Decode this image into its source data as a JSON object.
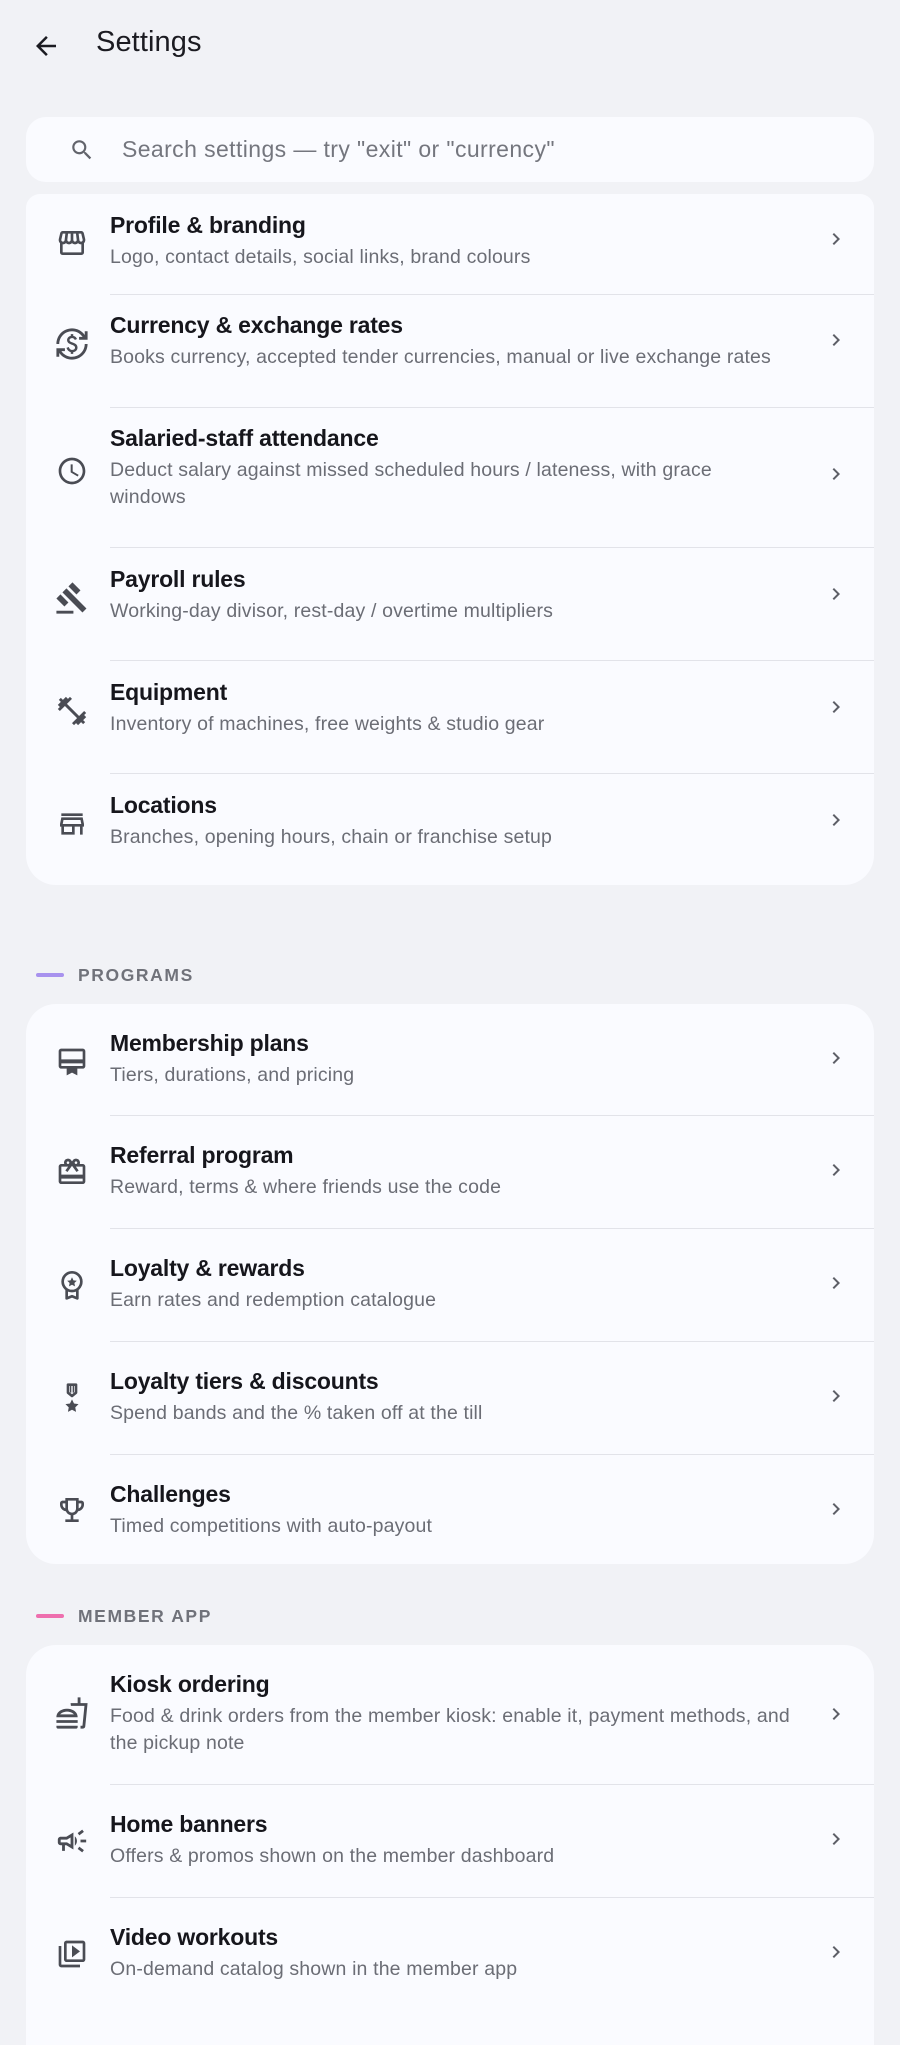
{
  "header": {
    "title": "Settings"
  },
  "search": {
    "placeholder": "Search settings — try \"exit\" or \"currency\""
  },
  "general": {
    "items": [
      {
        "title": "Profile & branding",
        "subtitle": "Logo, contact details, social links, brand colours",
        "icon": "storefront-icon"
      },
      {
        "title": "Currency & exchange rates",
        "subtitle": "Books currency, accepted tender currencies, manual or live exchange rates",
        "icon": "currency-exchange-icon"
      },
      {
        "title": "Salaried-staff attendance",
        "subtitle": "Deduct salary against missed scheduled hours / lateness, with grace windows",
        "icon": "clock-icon"
      },
      {
        "title": "Payroll rules",
        "subtitle": "Working-day divisor, rest-day / overtime multipliers",
        "icon": "gavel-icon"
      },
      {
        "title": "Equipment",
        "subtitle": "Inventory of machines, free weights & studio gear",
        "icon": "fitness-icon"
      },
      {
        "title": "Locations",
        "subtitle": "Branches, opening hours, chain or franchise setup",
        "icon": "store-icon"
      }
    ]
  },
  "programs": {
    "label": "PROGRAMS",
    "accent": "#a892ee",
    "items": [
      {
        "title": "Membership plans",
        "subtitle": "Tiers, durations, and pricing",
        "icon": "card-membership-icon"
      },
      {
        "title": "Referral program",
        "subtitle": "Reward, terms & where friends use the code",
        "icon": "gift-card-icon"
      },
      {
        "title": "Loyalty & rewards",
        "subtitle": "Earn rates and redemption catalogue",
        "icon": "award-star-icon"
      },
      {
        "title": "Loyalty tiers & discounts",
        "subtitle": "Spend bands and the % taken off at the till",
        "icon": "medal-icon"
      },
      {
        "title": "Challenges",
        "subtitle": "Timed competitions with auto-payout",
        "icon": "trophy-icon"
      }
    ]
  },
  "member_app": {
    "label": "MEMBER APP",
    "accent": "#ee6fae",
    "items": [
      {
        "title": "Kiosk ordering",
        "subtitle": "Food & drink orders from the member kiosk: enable it, payment methods, and the pickup note",
        "icon": "fastfood-icon"
      },
      {
        "title": "Home banners",
        "subtitle": "Offers & promos shown on the member dashboard",
        "icon": "campaign-icon"
      },
      {
        "title": "Video workouts",
        "subtitle": "On-demand catalog shown in the member app",
        "icon": "video-library-icon"
      }
    ]
  }
}
